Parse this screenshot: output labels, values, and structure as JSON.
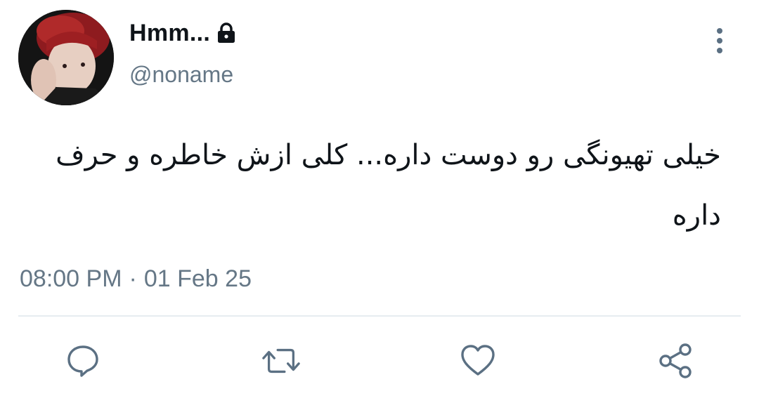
{
  "tweet": {
    "display_name": "Hmm...",
    "handle": "@noname",
    "text": "خیلی تهیونگی رو دوست داره... کلی ازش خاطره و حرف داره",
    "time": "08:00 PM",
    "separator": "·",
    "date": "01 Feb 25",
    "locked": true
  },
  "icons": {
    "lock": "lock-icon",
    "more": "more-vertical-icon",
    "reply": "reply-bubble-icon",
    "retweet": "retweet-icon",
    "like": "heart-icon",
    "share": "share-icon"
  },
  "colors": {
    "text_primary": "#0f1419",
    "text_secondary": "#657786",
    "divider": "#e6ecf0",
    "icon": "#5b7083"
  }
}
